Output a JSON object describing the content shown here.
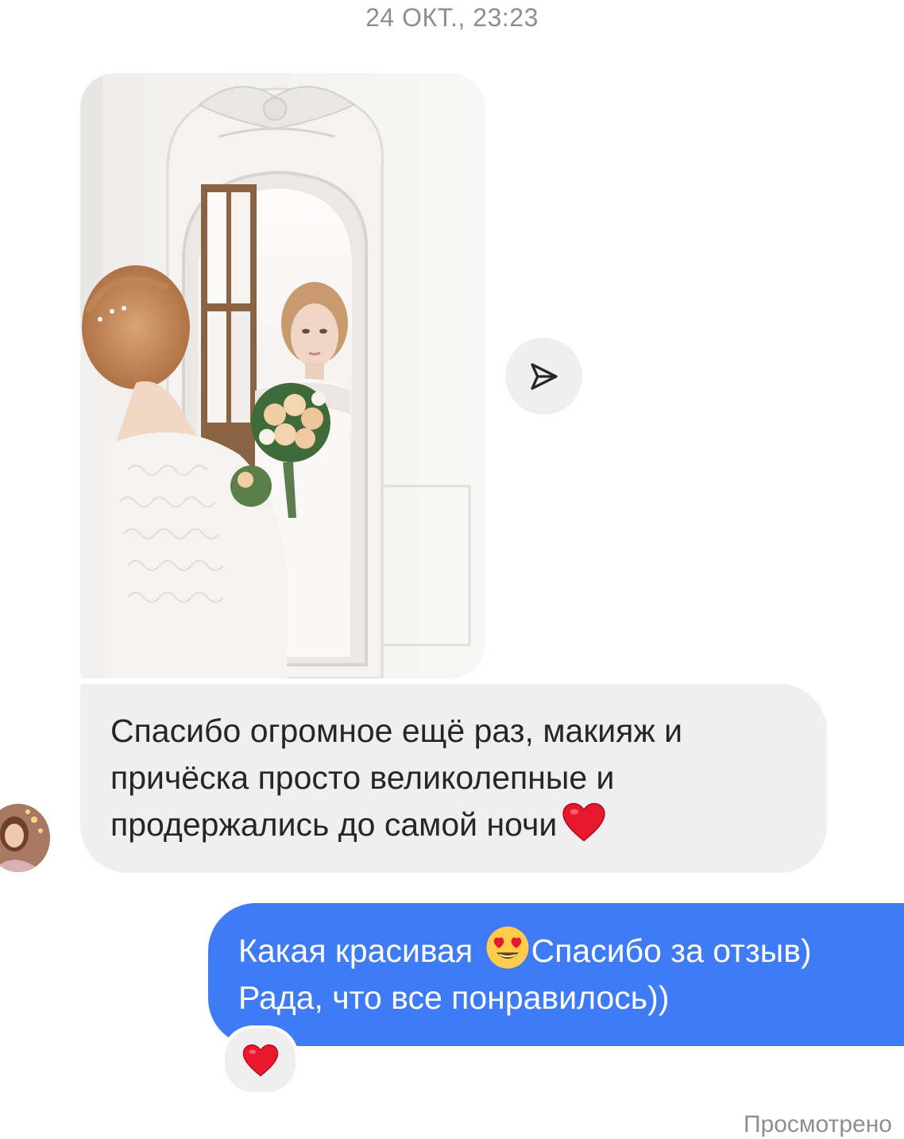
{
  "thread": {
    "timestamp": "24 ОКТ., 23:23",
    "incoming_message": {
      "line1": "Спасибо огромное ещё раз, макияж и",
      "line2": "причёска просто великолепные и",
      "line3": "продержались до самой ночи",
      "trailing_emoji": "red-heart"
    },
    "outgoing_message": {
      "line1_before_emoji": "Какая красивая ",
      "emoji": "smiling-face-with-heart-eyes",
      "line1_after_emoji": "Спасибо за отзыв)",
      "line2": "Рада, что все понравилось))"
    },
    "reaction_emoji": "red-heart",
    "seen_status": "Просмотрено"
  },
  "icons": {
    "share": "paper-plane-icon",
    "heart": "red-heart",
    "love_eyes": "smiling-face-with-heart-eyes"
  },
  "colors": {
    "outgoing_bubble": "#3e7bf5",
    "incoming_bubble": "#efefef",
    "timestamp_text": "#8e8e8e",
    "heart": "#e8182e"
  }
}
